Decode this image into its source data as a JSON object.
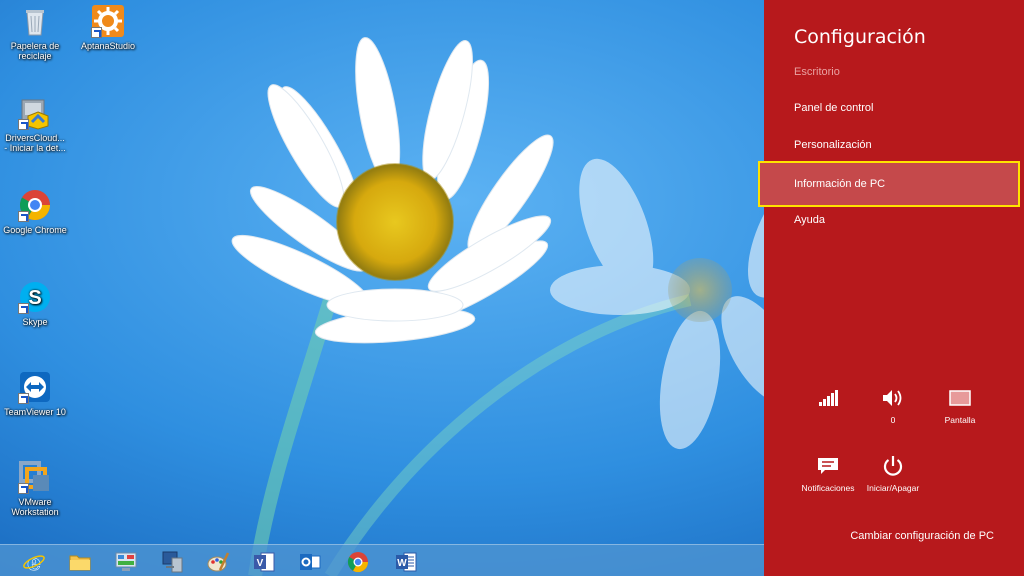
{
  "desktop": {
    "icons": [
      {
        "label_line1": "Papelera de",
        "label_line2": "reciclaje",
        "icon": "recycle-bin-icon"
      },
      {
        "label_line1": "AptanaStudio",
        "label_line2": "",
        "icon": "aptana-studio-icon"
      },
      {
        "label_line1": "DriversCloud...",
        "label_line2": "- Iniciar la det...",
        "icon": "driverscloud-icon"
      },
      {
        "label_line1": "Google Chrome",
        "label_line2": "",
        "icon": "chrome-icon"
      },
      {
        "label_line1": "Skype",
        "label_line2": "",
        "icon": "skype-icon"
      },
      {
        "label_line1": "TeamViewer 10",
        "label_line2": "",
        "icon": "teamviewer-icon"
      },
      {
        "label_line1": "VMware",
        "label_line2": "Workstation",
        "icon": "vmware-icon"
      }
    ]
  },
  "taskbar": {
    "items": [
      "internet-explorer-icon",
      "file-explorer-icon",
      "control-panel-icon",
      "computer-icon",
      "paint-icon",
      "visio-icon",
      "outlook-icon",
      "chrome-icon",
      "word-icon"
    ]
  },
  "settings": {
    "title": "Configuración",
    "context": "Escritorio",
    "links": [
      {
        "label": "Panel de control"
      },
      {
        "label": "Personalización"
      },
      {
        "label": "Información de PC",
        "active": true
      },
      {
        "label": "Ayuda"
      }
    ],
    "quick": {
      "network": {
        "label": "",
        "icon": "signal-bars-icon"
      },
      "volume": {
        "label": "0",
        "icon": "speaker-icon"
      },
      "screen": {
        "label": "Pantalla",
        "icon": "screen-icon"
      },
      "notifications": {
        "label": "Notificaciones",
        "icon": "notifications-icon"
      },
      "power": {
        "label": "Iniciar/Apagar",
        "icon": "power-icon"
      }
    },
    "change_link": "Cambiar configuración de PC",
    "colors": {
      "panel_bg": "#b7191c",
      "highlight": "#ffe300"
    }
  }
}
